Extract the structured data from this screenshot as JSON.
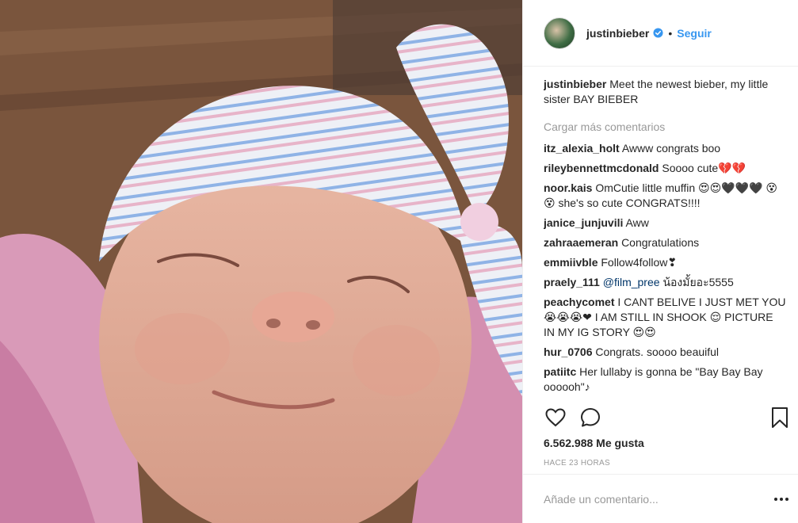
{
  "header": {
    "username": "justinbieber",
    "separator": "•",
    "follow_label": "Seguir"
  },
  "caption": {
    "username": "justinbieber",
    "text": "Meet the newest bieber, my little sister BAY BIEBER"
  },
  "load_more_label": "Cargar más comentarios",
  "comments": [
    {
      "user": "itz_alexia_holt",
      "text": "Awww congrats boo"
    },
    {
      "user": "rileybennettmcdonald",
      "text": "Soooo cute💔💔"
    },
    {
      "user": "noor.kais",
      "text": "OmCutie little muffin 😍😍🖤🖤🖤 😵😵 she's so cute CONGRATS!!!!"
    },
    {
      "user": "janice_junjuvili",
      "text": "Aww"
    },
    {
      "user": "zahraaemeran",
      "text": "Congratulations"
    },
    {
      "user": "emmiivble",
      "text": "Follow4follow❣"
    },
    {
      "user": "praely_111",
      "mention": "@film_pree",
      "text": "น้องมั้ยอะ5555"
    },
    {
      "user": "peachycomet",
      "text": "I CANT BELIVE I JUST MET YOU 😭😭😭❤ I AM STILL IN SHOOK 😌 PICTURE IN MY IG STORY 😍😍"
    },
    {
      "user": "hur_0706",
      "text": "Congrats. soooo beauiful"
    },
    {
      "user": "patiitc",
      "text": "Her lullaby is gonna be \"Bay Bay Bay oooooh\"♪"
    }
  ],
  "likes_text": "6.562.988 Me gusta",
  "time_text": "HACE 23 HORAS",
  "add_comment_placeholder": "Añade un comentario...",
  "icons": {
    "like": "heart-icon",
    "comment": "comment-bubble-icon",
    "save": "bookmark-icon",
    "verified": "verified-badge-icon",
    "options": "more-options-icon"
  },
  "colors": {
    "link_blue": "#3897f0",
    "muted": "#999999",
    "text": "#262626"
  }
}
